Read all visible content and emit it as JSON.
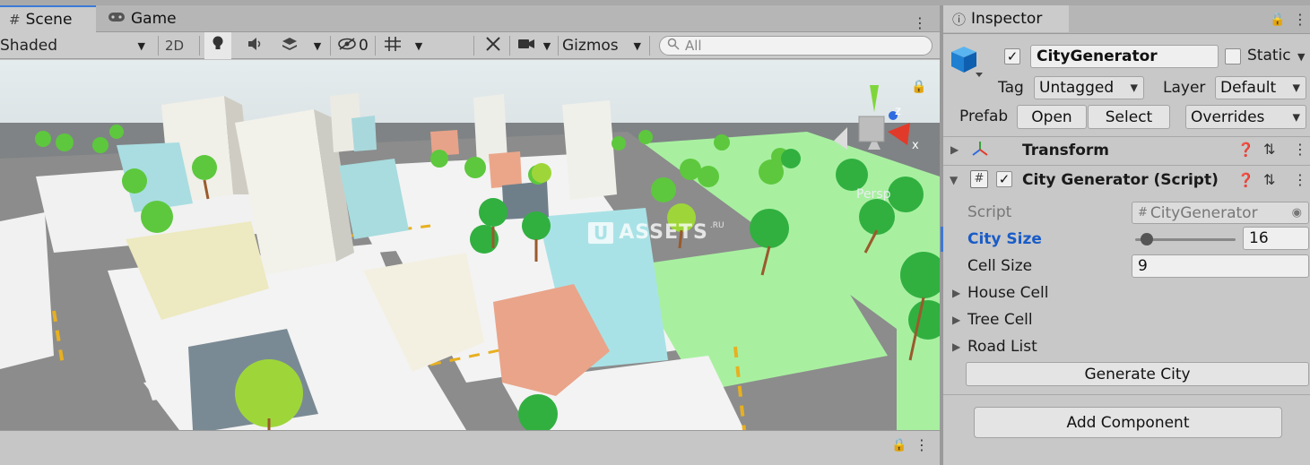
{
  "scene_panel": {
    "tabs": [
      {
        "label": "Scene",
        "icon": "hash-grid-icon"
      },
      {
        "label": "Game",
        "icon": "gamepad-icon"
      }
    ],
    "toolbar": {
      "draw_mode": "Shaded",
      "mode_2d": "2D",
      "hidden_count": "0",
      "gizmos": "Gizmos",
      "search_placeholder": "All"
    },
    "view": {
      "watermark": "ASSETS",
      "watermark_badge": "U",
      "watermark_sub": ".RU",
      "gizmo_x": "x",
      "gizmo_z": "z",
      "persp_label": "Persp"
    }
  },
  "inspector": {
    "tab_label": "Inspector",
    "object": {
      "name": "CityGenerator",
      "active": true,
      "static_label": "Static",
      "tag_label": "Tag",
      "tag_value": "Untagged",
      "layer_label": "Layer",
      "layer_value": "Default",
      "prefab_label": "Prefab",
      "open_label": "Open",
      "select_label": "Select",
      "overrides_label": "Overrides"
    },
    "components": [
      {
        "name": "Transform"
      },
      {
        "name": "City Generator (Script)",
        "enabled": true
      }
    ],
    "script_fields": {
      "script_label": "Script",
      "script_value": "CityGenerator",
      "city_size_label": "City Size",
      "city_size_value": "16",
      "city_size_slider": 0.05,
      "cell_size_label": "Cell Size",
      "cell_size_value": "9",
      "house_cell_label": "House Cell",
      "tree_cell_label": "Tree Cell",
      "road_list_label": "Road List",
      "generate_label": "Generate City"
    },
    "add_component_label": "Add Component"
  },
  "colors": {
    "accent": "#3b7ad6",
    "grass": "#a8f0a0",
    "road": "#8a8a8a",
    "sky": "#dfe7ea"
  }
}
